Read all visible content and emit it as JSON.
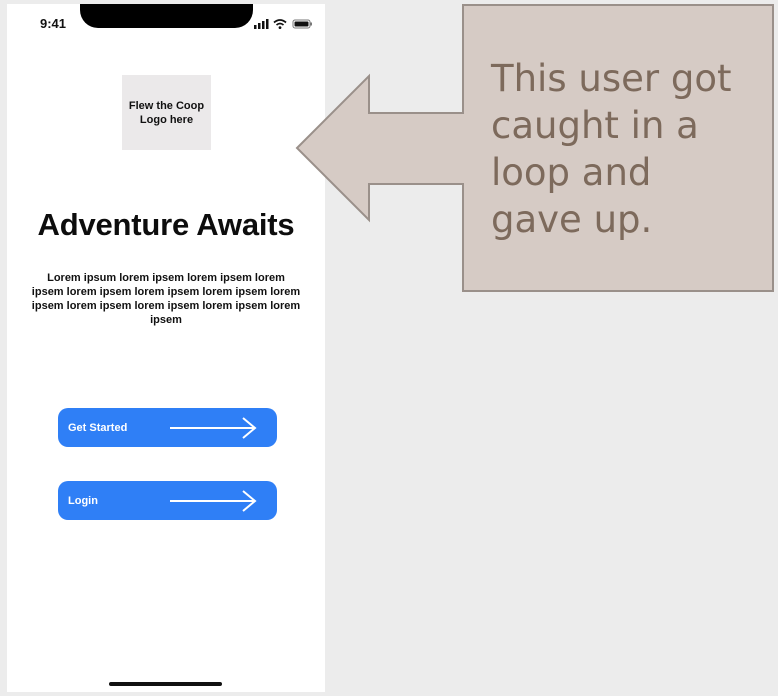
{
  "status_bar": {
    "time": "9:41",
    "icons": [
      "signal-icon",
      "wifi-icon",
      "battery-icon"
    ]
  },
  "logo": {
    "text": "Flew the Coop\nLogo here"
  },
  "headline": "Adventure Awaits",
  "body_text": "Lorem ipsum lorem ipsem  lorem ipsem  lorem ipsem  lorem ipsem  lorem ipsem  lorem ipsem lorem ipsem  lorem ipsem  lorem ipsem  lorem ipsem  lorem ipsem",
  "buttons": {
    "get_started": "Get Started",
    "login": "Login"
  },
  "callout": {
    "text": "This user got\ncaught in a\nloop and\ngave up.",
    "fill_color": "#d6cbc5",
    "text_color": "#7d6a5c"
  },
  "colors": {
    "background": "#ececec",
    "button": "#2f7ff6"
  }
}
